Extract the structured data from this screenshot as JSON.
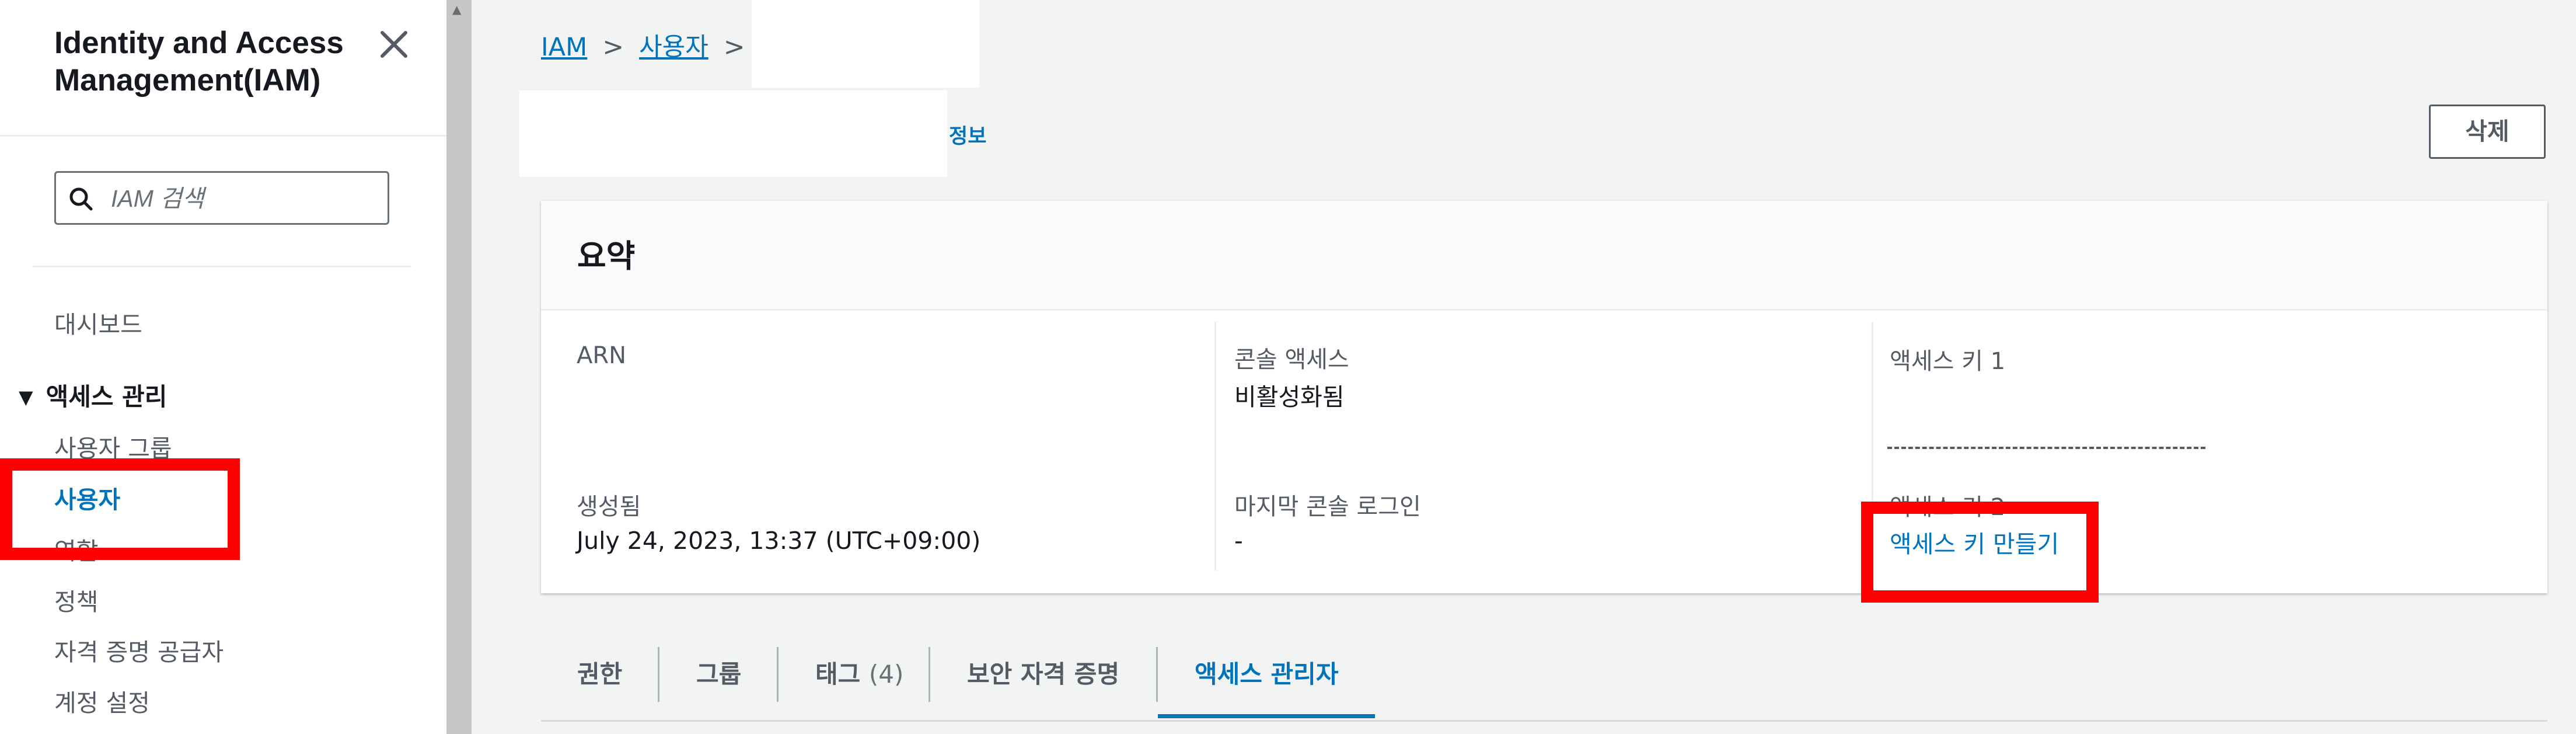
{
  "sidebar": {
    "app_title": "Identity and Access Management(IAM)",
    "search_placeholder": "IAM 검색",
    "dashboard": "대시보드",
    "access_management": "액세스 관리",
    "items": [
      {
        "label": "사용자 그룹"
      },
      {
        "label": "사용자"
      },
      {
        "label": "역할"
      },
      {
        "label": "정책"
      },
      {
        "label": "자격 증명 공급자"
      },
      {
        "label": "계정 설정"
      }
    ],
    "active_item": "사용자"
  },
  "breadcrumb": {
    "items": [
      "IAM",
      "사용자"
    ]
  },
  "header": {
    "info_link": "정보",
    "delete_button": "삭제"
  },
  "summary": {
    "title": "요약",
    "arn_label": "ARN",
    "created_label": "생성됨",
    "created_value": "July 24, 2023, 13:37 (UTC+09:00)",
    "console_access_label": "콘솔 액세스",
    "console_access_value": "비활성화됨",
    "last_login_label": "마지막 콘솔 로그인",
    "last_login_value": "-",
    "access_key1_label": "액세스 키 1",
    "access_key2_label": "액세스 키 2",
    "create_access_key_link": "액세스 키 만들기"
  },
  "tabs": [
    {
      "label": "권한"
    },
    {
      "label": "그룹"
    },
    {
      "label": "태그",
      "count": "(4)"
    },
    {
      "label": "보안 자격 증명"
    },
    {
      "label": "액세스 관리자"
    }
  ],
  "active_tab": "액세스 관리자",
  "colors": {
    "link": "#0073bb",
    "highlight": "#ff0000",
    "text": "#16191f",
    "secondary_text": "#545b64"
  }
}
